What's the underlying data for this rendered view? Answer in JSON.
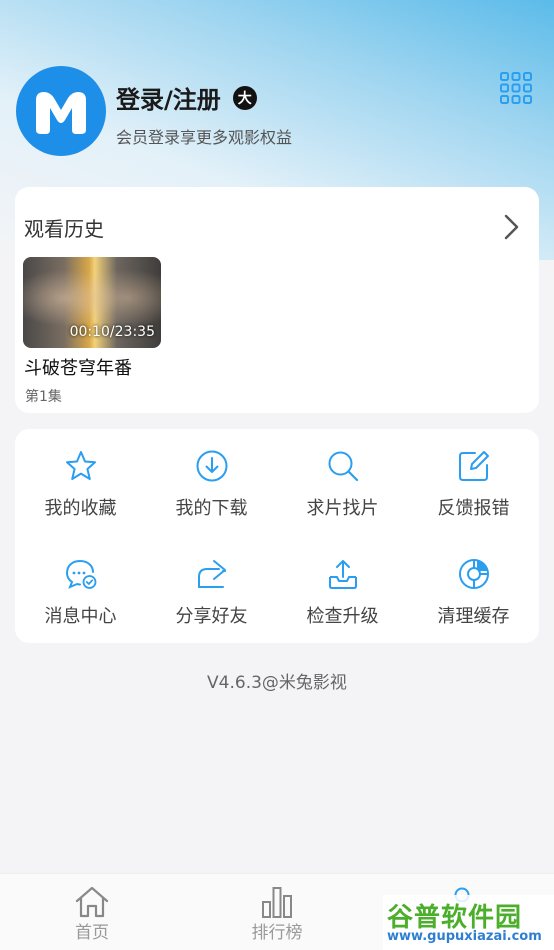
{
  "profile": {
    "title": "登录/注册",
    "badge": "大",
    "subtitle": "会员登录享更多观影权益"
  },
  "history": {
    "title": "观看历史",
    "items": [
      {
        "time": "00:10/23:35",
        "title": "斗破苍穹年番",
        "episode": "第1集"
      }
    ]
  },
  "menu": [
    {
      "label": "我的收藏",
      "icon": "star-icon"
    },
    {
      "label": "我的下载",
      "icon": "download-icon"
    },
    {
      "label": "求片找片",
      "icon": "search-icon"
    },
    {
      "label": "反馈报错",
      "icon": "edit-icon"
    },
    {
      "label": "消息中心",
      "icon": "message-icon"
    },
    {
      "label": "分享好友",
      "icon": "share-icon"
    },
    {
      "label": "检查升级",
      "icon": "upload-icon"
    },
    {
      "label": "清理缓存",
      "icon": "cache-icon"
    }
  ],
  "version": "V4.6.3@米兔影视",
  "tabs": [
    {
      "label": "首页",
      "icon": "home-icon"
    },
    {
      "label": "排行榜",
      "icon": "ranking-icon"
    }
  ],
  "watermark": {
    "top": "谷普软件园",
    "bottom": "www.gupuxiazai.com"
  },
  "colors": {
    "accent": "#2a9ef0",
    "brand": "#1e8fe8"
  }
}
